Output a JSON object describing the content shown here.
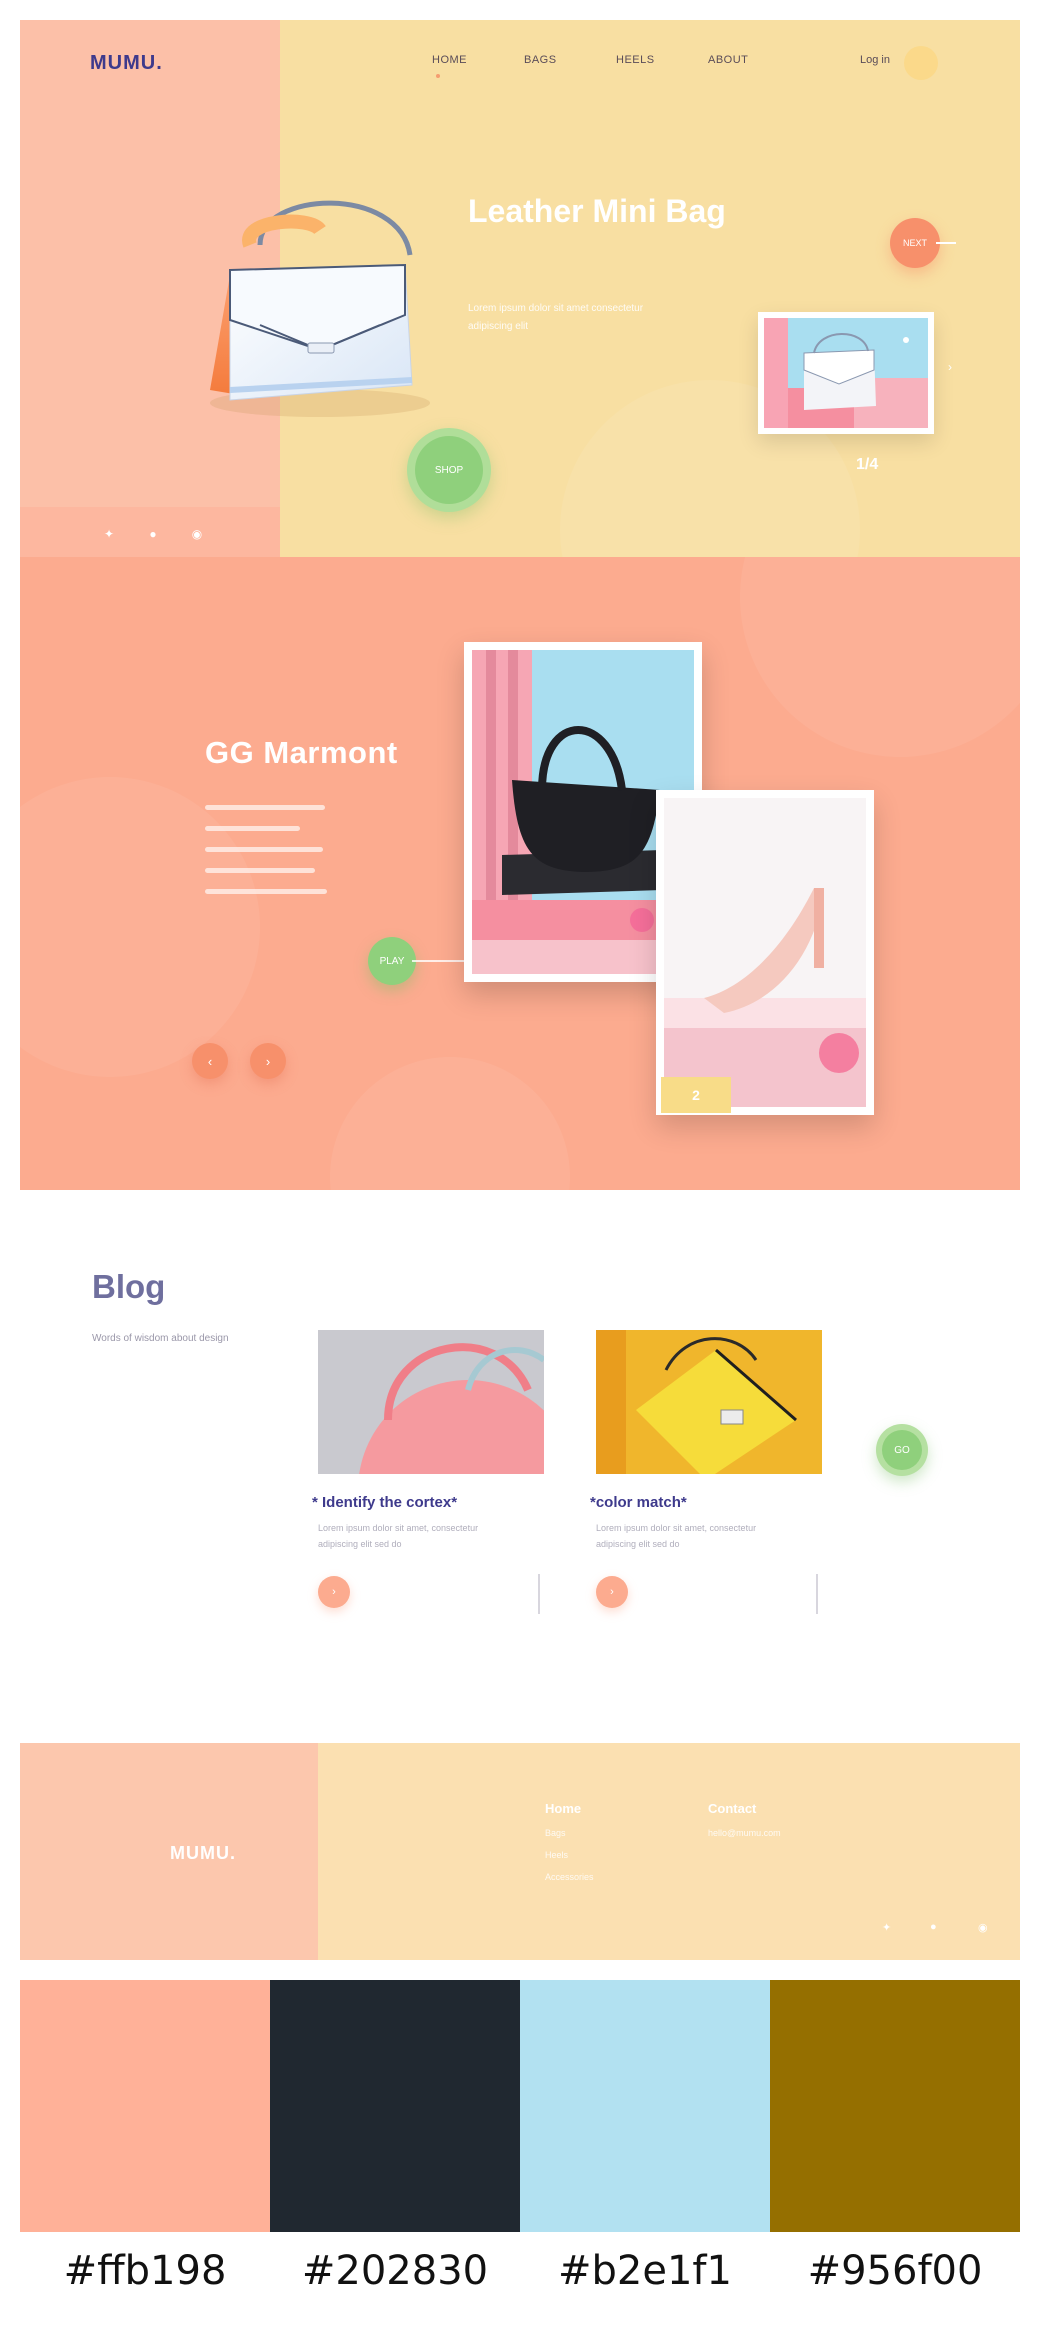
{
  "hero": {
    "logo": "MUMU.",
    "nav": [
      "HOME",
      "BAGS",
      "HEELS",
      "ABOUT"
    ],
    "login": "Log in",
    "title": "Leather Mini Bag",
    "subtitle": "Lorem ipsum dolor sit amet consectetur adipiscing elit",
    "next_button": "NEXT",
    "shop_button": "SHOP",
    "counter": "1/4",
    "social": [
      "twitter-icon",
      "facebook-icon",
      "instagram-icon"
    ],
    "colors": {
      "left": "#fcc0a8",
      "right": "#f8dfa2",
      "accent": "#f7906b",
      "green": "#8fd07c"
    }
  },
  "section2": {
    "title": "GG Marmont",
    "play_button": "PLAY",
    "photo_tag": "2"
  },
  "blog": {
    "title": "Blog",
    "description": "Words of wisdom about design",
    "cards": [
      {
        "title": "* Identify the cortex*",
        "text": "Lorem ipsum dolor sit amet, consectetur adipiscing elit sed do"
      },
      {
        "title": "*color match*",
        "text": "Lorem ipsum dolor sit amet, consectetur adipiscing elit sed do"
      }
    ],
    "next_button": "GO"
  },
  "footer": {
    "logo": "MUMU.",
    "col1_head": "Home",
    "col1_links": [
      "Bags",
      "Heels",
      "Accessories"
    ],
    "col2_head": "Contact",
    "col2_links": [
      "hello@mumu.com"
    ],
    "social": [
      "twitter-icon",
      "facebook-icon",
      "instagram-icon"
    ]
  },
  "palette": [
    {
      "hex": "#ffb198",
      "label": "#ffb198"
    },
    {
      "hex": "#202830",
      "label": "#202830"
    },
    {
      "hex": "#b2e1f1",
      "label": "#b2e1f1"
    },
    {
      "hex": "#956f00",
      "label": "#956f00"
    }
  ]
}
